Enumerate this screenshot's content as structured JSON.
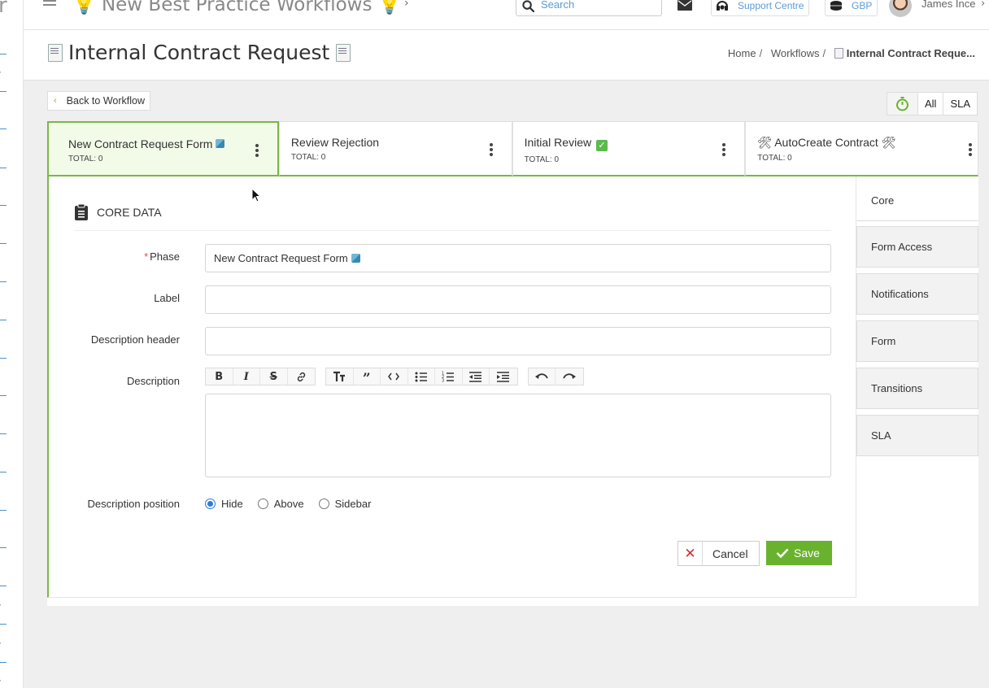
{
  "app": {
    "title": "New Best Practice Workflows",
    "search_placeholder": "Search",
    "support_label": "Support Centre",
    "currency_label": "GBP",
    "user_name": "James Ince"
  },
  "page": {
    "title": "Internal Contract Request",
    "breadcrumb": [
      "Home",
      "Workflows",
      "Internal Contract Reque..."
    ]
  },
  "toolbar": {
    "back_label": "Back to Workflow",
    "filter_all": "All",
    "filter_sla": "SLA"
  },
  "phases": [
    {
      "name": "New Contract Request Form",
      "total": "TOTAL: 0",
      "active": true
    },
    {
      "name": "Review Rejection",
      "total": "TOTAL: 0",
      "active": false
    },
    {
      "name": "Initial Review",
      "total": "TOTAL: 0",
      "active": false
    },
    {
      "name": "AutoCreate Contract",
      "total": "TOTAL: 0",
      "active": false
    }
  ],
  "side_tabs": [
    "Core",
    "Form Access",
    "Notifications",
    "Form",
    "Transitions",
    "SLA"
  ],
  "form": {
    "section_title": "CORE DATA",
    "phase_label": "Phase",
    "phase_value": "New Contract Request Form",
    "label_label": "Label",
    "label_value": "",
    "desc_header_label": "Description header",
    "desc_header_value": "",
    "description_label": "Description",
    "position_label": "Description position",
    "position_options": [
      "Hide",
      "Above",
      "Sidebar"
    ],
    "position_selected": "Hide",
    "cancel_label": "Cancel",
    "save_label": "Save"
  },
  "colors": {
    "accent_green": "#7ab648",
    "save_green": "#69b22e",
    "link_blue": "#5b9bd5",
    "radio_blue": "#2d7be0",
    "cancel_red": "#d9292f"
  }
}
